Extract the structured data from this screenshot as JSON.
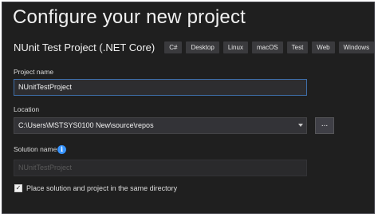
{
  "title": "Configure your new project",
  "template": {
    "name": "NUnit Test Project (.NET Core)",
    "tags": [
      "C#",
      "Desktop",
      "Linux",
      "macOS",
      "Test",
      "Web",
      "Windows"
    ]
  },
  "project_name": {
    "label": "Project name",
    "value": "NUnitTestProject"
  },
  "location": {
    "label": "Location",
    "value": "C:\\Users\\MSTSYS0100 New\\source\\repos",
    "browse_label": "..."
  },
  "solution_name": {
    "label": "Solution name",
    "value": "NUnitTestProject",
    "info_icon": "info-icon"
  },
  "same_directory": {
    "checked": true,
    "check_glyph": "✓",
    "label": "Place solution and project in the same directory"
  },
  "colors": {
    "accent": "#3794ff",
    "background": "#1f1f1f",
    "field": "#333337",
    "focus_border": "#3e6ea9"
  }
}
